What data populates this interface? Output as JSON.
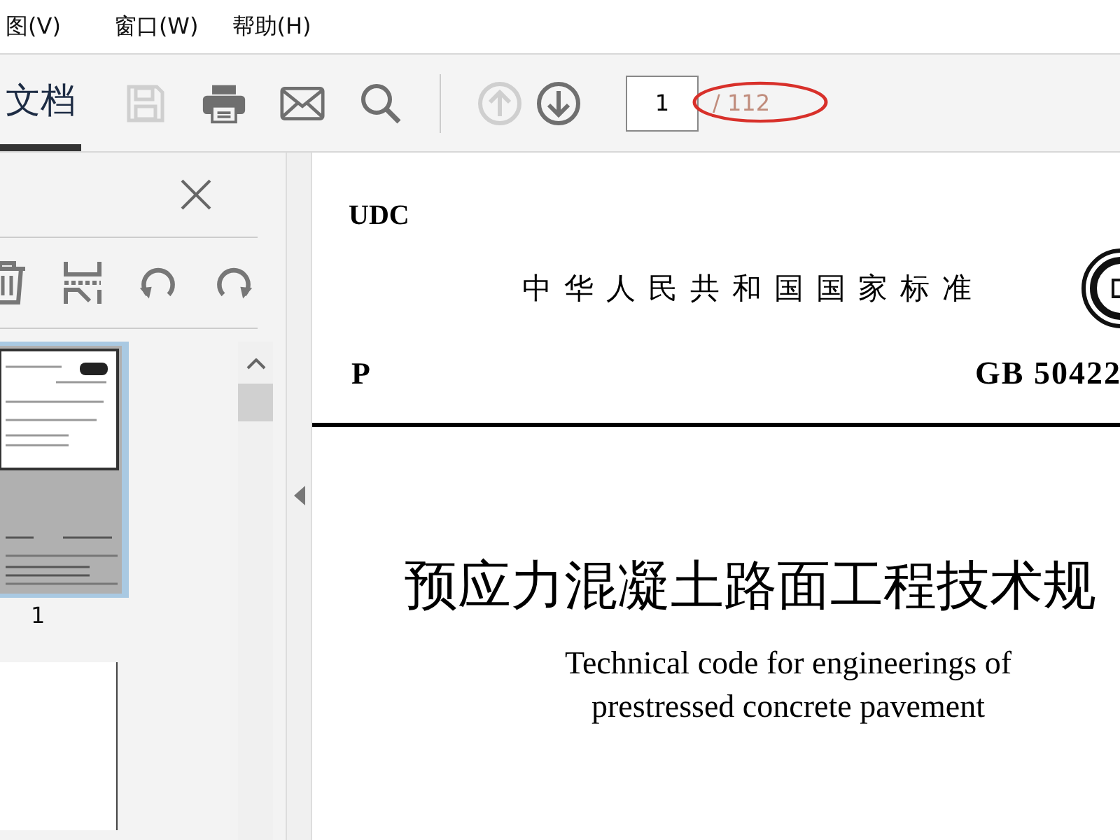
{
  "menu": [
    {
      "label": "图(V)"
    },
    {
      "label": "窗口(W)"
    },
    {
      "label": "帮助(H)"
    }
  ],
  "toolbar": {
    "tab": {
      "label": "文档",
      "selected": true
    },
    "tools": [
      {
        "kind": "save",
        "disabled": true
      },
      {
        "kind": "print",
        "disabled": false
      },
      {
        "kind": "mail",
        "disabled": false
      },
      {
        "kind": "search",
        "disabled": false
      },
      {
        "kind": "separator"
      },
      {
        "kind": "up",
        "disabled": true
      },
      {
        "kind": "down",
        "disabled": false
      }
    ],
    "page_field": {
      "value": "1"
    },
    "page_total": "/ 112"
  },
  "sidebar": {
    "tools": [
      {
        "kind": "delete"
      },
      {
        "kind": "extract"
      },
      {
        "kind": "rotate-left"
      },
      {
        "kind": "rotate-right"
      }
    ],
    "thumbnails": [
      {
        "label": "1",
        "selected": true
      }
    ]
  },
  "document": {
    "udc": "UDC",
    "standard_title": "中华人民共和国国家标准",
    "class_code": "P",
    "standard_number": "GB 50422",
    "title": "预应力混凝土路面工程技术规",
    "english_title": [
      "Technical code for engineerings of",
      "prestressed concrete pavement"
    ]
  }
}
